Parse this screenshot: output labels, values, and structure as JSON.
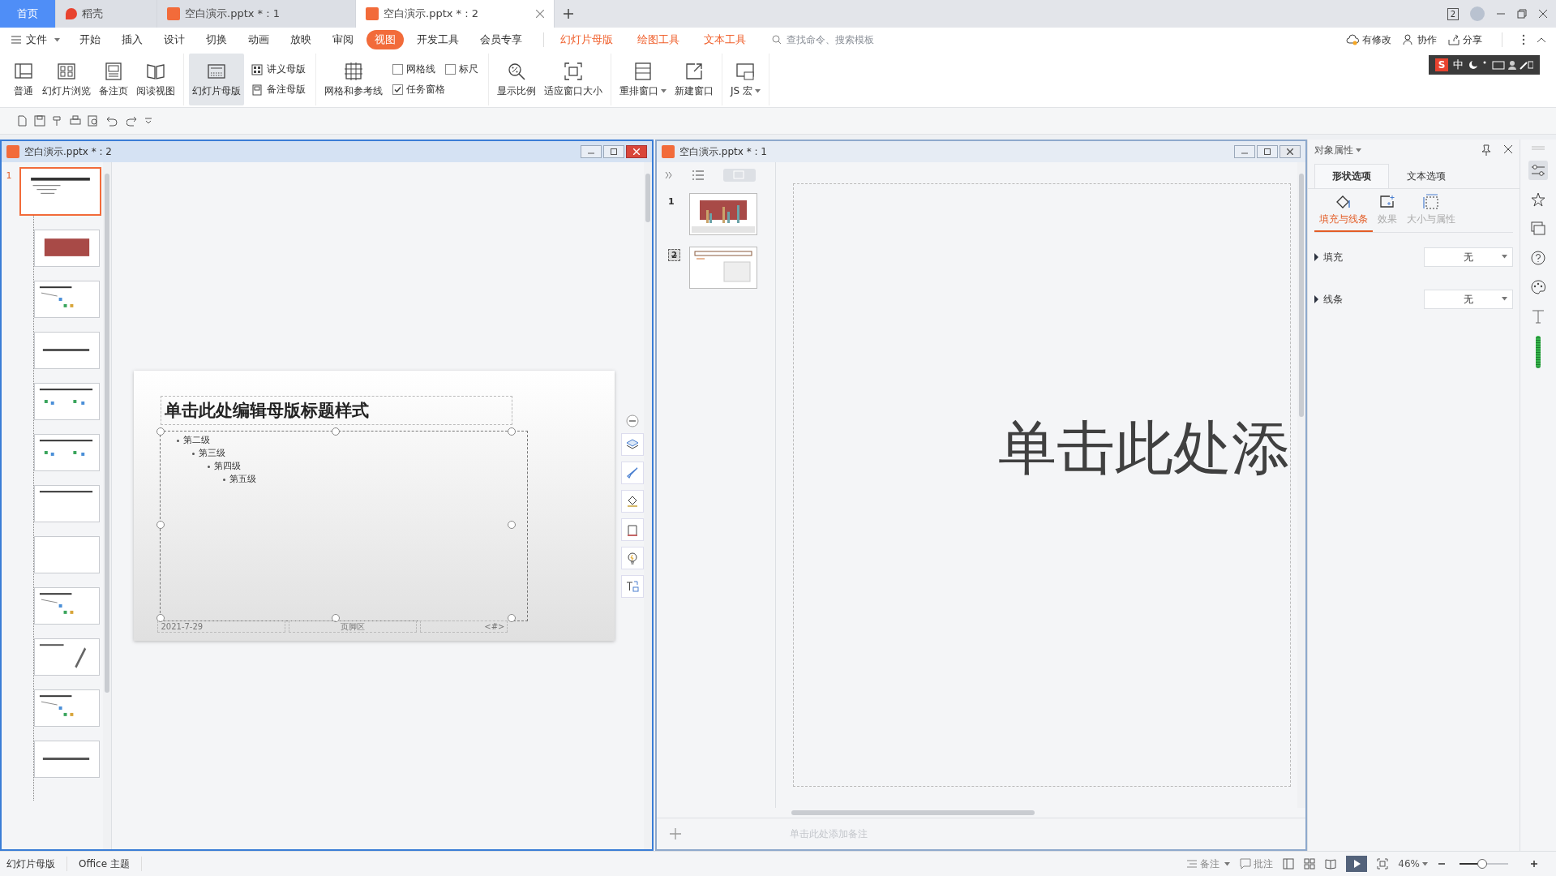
{
  "doc_tabs": [
    {
      "label": "首页",
      "kind": "home",
      "selected": false
    },
    {
      "label": "稻壳",
      "kind": "docer",
      "selected": false
    },
    {
      "label": "空白演示.pptx * : 1",
      "kind": "file",
      "selected": false
    },
    {
      "label": "空白演示.pptx * : 2",
      "kind": "file",
      "selected": true
    }
  ],
  "window_badge": "2",
  "menu": {
    "file": "文件",
    "tabs": [
      {
        "label": "开始",
        "kind": "main",
        "selected": false
      },
      {
        "label": "插入",
        "kind": "main",
        "selected": false
      },
      {
        "label": "设计",
        "kind": "main",
        "selected": false
      },
      {
        "label": "切换",
        "kind": "main",
        "selected": false
      },
      {
        "label": "动画",
        "kind": "main",
        "selected": false
      },
      {
        "label": "放映",
        "kind": "main",
        "selected": false
      },
      {
        "label": "审阅",
        "kind": "main",
        "selected": false
      },
      {
        "label": "视图",
        "kind": "main",
        "selected": true
      },
      {
        "label": "开发工具",
        "kind": "main",
        "selected": false
      },
      {
        "label": "会员专享",
        "kind": "main",
        "selected": false
      },
      {
        "label": "幻灯片母版",
        "kind": "context",
        "selected": false
      },
      {
        "label": "绘图工具",
        "kind": "context",
        "selected": false
      },
      {
        "label": "文本工具",
        "kind": "context",
        "selected": false
      }
    ],
    "search": {
      "placeholder": "查找命令、搜索模板"
    },
    "actions": [
      "有修改",
      "协作",
      "分享"
    ]
  },
  "ribbon_groups": [
    {
      "items": [
        {
          "kind": "large",
          "label": "普通",
          "selected": false,
          "dropdown": false
        },
        {
          "kind": "large",
          "label": "幻灯片浏览",
          "selected": false,
          "dropdown": false
        },
        {
          "kind": "large",
          "label": "备注页",
          "selected": false,
          "dropdown": false
        },
        {
          "kind": "large",
          "label": "阅读视图",
          "selected": false,
          "dropdown": false
        }
      ]
    },
    {
      "items": [
        {
          "kind": "large",
          "label": "幻灯片母版",
          "selected": true,
          "dropdown": false
        },
        {
          "kind": "stack",
          "rows": [
            [
              {
                "kind": "small",
                "label": "讲义母版"
              }
            ],
            [
              {
                "kind": "small",
                "label": "备注母版"
              }
            ]
          ]
        }
      ]
    },
    {
      "items": [
        {
          "kind": "large",
          "label": "网格和参考线",
          "selected": false,
          "dropdown": false
        },
        {
          "kind": "stack",
          "rows": [
            [
              {
                "kind": "checkbox",
                "label": "网格线",
                "checked": false
              },
              {
                "kind": "checkbox",
                "label": "标尺",
                "checked": false
              }
            ],
            [
              {
                "kind": "checkbox",
                "label": "任务窗格",
                "checked": true
              }
            ]
          ]
        }
      ]
    },
    {
      "items": [
        {
          "kind": "large",
          "label": "显示比例",
          "selected": false,
          "dropdown": false
        },
        {
          "kind": "large",
          "label": "适应窗口大小",
          "selected": false,
          "dropdown": false
        }
      ]
    },
    {
      "items": [
        {
          "kind": "large",
          "label": "重排窗口",
          "selected": false,
          "dropdown": true
        },
        {
          "kind": "large",
          "label": "新建窗口",
          "selected": false,
          "dropdown": false
        }
      ]
    },
    {
      "items": [
        {
          "kind": "large",
          "label": "JS 宏",
          "selected": false,
          "dropdown": true
        }
      ]
    }
  ],
  "ime_toolbar": {
    "logo": "S",
    "mode": "中"
  },
  "left_window": {
    "title": "空白演示.pptx * : 2",
    "active": true,
    "thumbnails": [
      {
        "kind": "master",
        "number": "1",
        "selected": true
      },
      {
        "kind": "red",
        "selected": false
      },
      {
        "kind": "diagram",
        "selected": false
      },
      {
        "kind": "band",
        "selected": false
      },
      {
        "kind": "two",
        "selected": false
      },
      {
        "kind": "two",
        "selected": false
      },
      {
        "kind": "titleonly",
        "selected": false
      },
      {
        "kind": "blank",
        "selected": false
      },
      {
        "kind": "diagram",
        "selected": false
      },
      {
        "kind": "slant",
        "selected": false
      },
      {
        "kind": "diagram",
        "selected": false
      },
      {
        "kind": "band",
        "selected": false
      }
    ],
    "slide": {
      "title": "单击此处编辑母版标题样式",
      "levels": [
        {
          "text": "第二级",
          "children": [
            {
              "text": "第三级",
              "children": [
                {
                  "text": "第四级",
                  "children": [
                    {
                      "text": "第五级"
                    }
                  ]
                }
              ]
            }
          ]
        }
      ],
      "footer": [
        "2021-7-29",
        "页脚区",
        "<#>"
      ]
    }
  },
  "right_window": {
    "title": "空白演示.pptx * : 1",
    "active": false,
    "slides": [
      {
        "number": "1",
        "kind": "chart",
        "hidden": false,
        "selected": false
      },
      {
        "number": "2",
        "kind": "text",
        "hidden": true,
        "selected": false
      }
    ],
    "slide_text": "单击此处添",
    "notes_placeholder": "单击此处添加备注"
  },
  "panel": {
    "title": "对象属性",
    "tabs": [
      {
        "label": "形状选项",
        "selected": true
      },
      {
        "label": "文本选项",
        "selected": false
      }
    ],
    "subtabs": [
      {
        "label": "填充与线条",
        "selected": true
      },
      {
        "label": "效果",
        "selected": false
      },
      {
        "label": "大小与属性",
        "selected": false
      }
    ],
    "rows": [
      {
        "label": "填充",
        "value": "无",
        "expanded": false
      },
      {
        "label": "线条",
        "value": "无",
        "expanded": false
      }
    ]
  },
  "status_bar": {
    "items": [
      "幻灯片母版",
      "Office 主题"
    ],
    "notes": "备注",
    "comments": "批注",
    "zoom": "46%",
    "zoom_slider": {
      "level": 0.45
    }
  }
}
